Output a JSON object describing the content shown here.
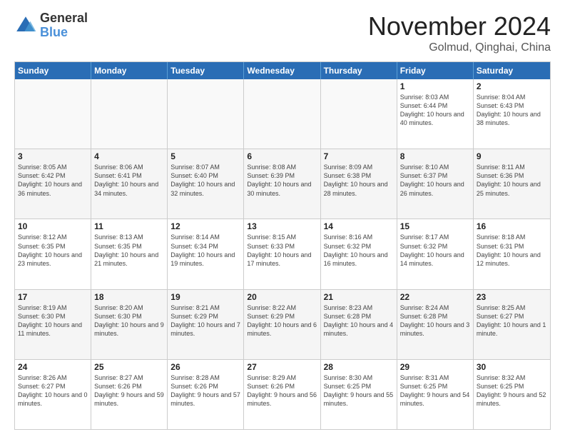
{
  "logo": {
    "general": "General",
    "blue": "Blue"
  },
  "title": "November 2024",
  "location": "Golmud, Qinghai, China",
  "header_days": [
    "Sunday",
    "Monday",
    "Tuesday",
    "Wednesday",
    "Thursday",
    "Friday",
    "Saturday"
  ],
  "rows": [
    [
      {
        "day": "",
        "info": ""
      },
      {
        "day": "",
        "info": ""
      },
      {
        "day": "",
        "info": ""
      },
      {
        "day": "",
        "info": ""
      },
      {
        "day": "",
        "info": ""
      },
      {
        "day": "1",
        "info": "Sunrise: 8:03 AM\nSunset: 6:44 PM\nDaylight: 10 hours and 40 minutes."
      },
      {
        "day": "2",
        "info": "Sunrise: 8:04 AM\nSunset: 6:43 PM\nDaylight: 10 hours and 38 minutes."
      }
    ],
    [
      {
        "day": "3",
        "info": "Sunrise: 8:05 AM\nSunset: 6:42 PM\nDaylight: 10 hours and 36 minutes."
      },
      {
        "day": "4",
        "info": "Sunrise: 8:06 AM\nSunset: 6:41 PM\nDaylight: 10 hours and 34 minutes."
      },
      {
        "day": "5",
        "info": "Sunrise: 8:07 AM\nSunset: 6:40 PM\nDaylight: 10 hours and 32 minutes."
      },
      {
        "day": "6",
        "info": "Sunrise: 8:08 AM\nSunset: 6:39 PM\nDaylight: 10 hours and 30 minutes."
      },
      {
        "day": "7",
        "info": "Sunrise: 8:09 AM\nSunset: 6:38 PM\nDaylight: 10 hours and 28 minutes."
      },
      {
        "day": "8",
        "info": "Sunrise: 8:10 AM\nSunset: 6:37 PM\nDaylight: 10 hours and 26 minutes."
      },
      {
        "day": "9",
        "info": "Sunrise: 8:11 AM\nSunset: 6:36 PM\nDaylight: 10 hours and 25 minutes."
      }
    ],
    [
      {
        "day": "10",
        "info": "Sunrise: 8:12 AM\nSunset: 6:35 PM\nDaylight: 10 hours and 23 minutes."
      },
      {
        "day": "11",
        "info": "Sunrise: 8:13 AM\nSunset: 6:35 PM\nDaylight: 10 hours and 21 minutes."
      },
      {
        "day": "12",
        "info": "Sunrise: 8:14 AM\nSunset: 6:34 PM\nDaylight: 10 hours and 19 minutes."
      },
      {
        "day": "13",
        "info": "Sunrise: 8:15 AM\nSunset: 6:33 PM\nDaylight: 10 hours and 17 minutes."
      },
      {
        "day": "14",
        "info": "Sunrise: 8:16 AM\nSunset: 6:32 PM\nDaylight: 10 hours and 16 minutes."
      },
      {
        "day": "15",
        "info": "Sunrise: 8:17 AM\nSunset: 6:32 PM\nDaylight: 10 hours and 14 minutes."
      },
      {
        "day": "16",
        "info": "Sunrise: 8:18 AM\nSunset: 6:31 PM\nDaylight: 10 hours and 12 minutes."
      }
    ],
    [
      {
        "day": "17",
        "info": "Sunrise: 8:19 AM\nSunset: 6:30 PM\nDaylight: 10 hours and 11 minutes."
      },
      {
        "day": "18",
        "info": "Sunrise: 8:20 AM\nSunset: 6:30 PM\nDaylight: 10 hours and 9 minutes."
      },
      {
        "day": "19",
        "info": "Sunrise: 8:21 AM\nSunset: 6:29 PM\nDaylight: 10 hours and 7 minutes."
      },
      {
        "day": "20",
        "info": "Sunrise: 8:22 AM\nSunset: 6:29 PM\nDaylight: 10 hours and 6 minutes."
      },
      {
        "day": "21",
        "info": "Sunrise: 8:23 AM\nSunset: 6:28 PM\nDaylight: 10 hours and 4 minutes."
      },
      {
        "day": "22",
        "info": "Sunrise: 8:24 AM\nSunset: 6:28 PM\nDaylight: 10 hours and 3 minutes."
      },
      {
        "day": "23",
        "info": "Sunrise: 8:25 AM\nSunset: 6:27 PM\nDaylight: 10 hours and 1 minute."
      }
    ],
    [
      {
        "day": "24",
        "info": "Sunrise: 8:26 AM\nSunset: 6:27 PM\nDaylight: 10 hours and 0 minutes."
      },
      {
        "day": "25",
        "info": "Sunrise: 8:27 AM\nSunset: 6:26 PM\nDaylight: 9 hours and 59 minutes."
      },
      {
        "day": "26",
        "info": "Sunrise: 8:28 AM\nSunset: 6:26 PM\nDaylight: 9 hours and 57 minutes."
      },
      {
        "day": "27",
        "info": "Sunrise: 8:29 AM\nSunset: 6:26 PM\nDaylight: 9 hours and 56 minutes."
      },
      {
        "day": "28",
        "info": "Sunrise: 8:30 AM\nSunset: 6:25 PM\nDaylight: 9 hours and 55 minutes."
      },
      {
        "day": "29",
        "info": "Sunrise: 8:31 AM\nSunset: 6:25 PM\nDaylight: 9 hours and 54 minutes."
      },
      {
        "day": "30",
        "info": "Sunrise: 8:32 AM\nSunset: 6:25 PM\nDaylight: 9 hours and 52 minutes."
      }
    ]
  ]
}
